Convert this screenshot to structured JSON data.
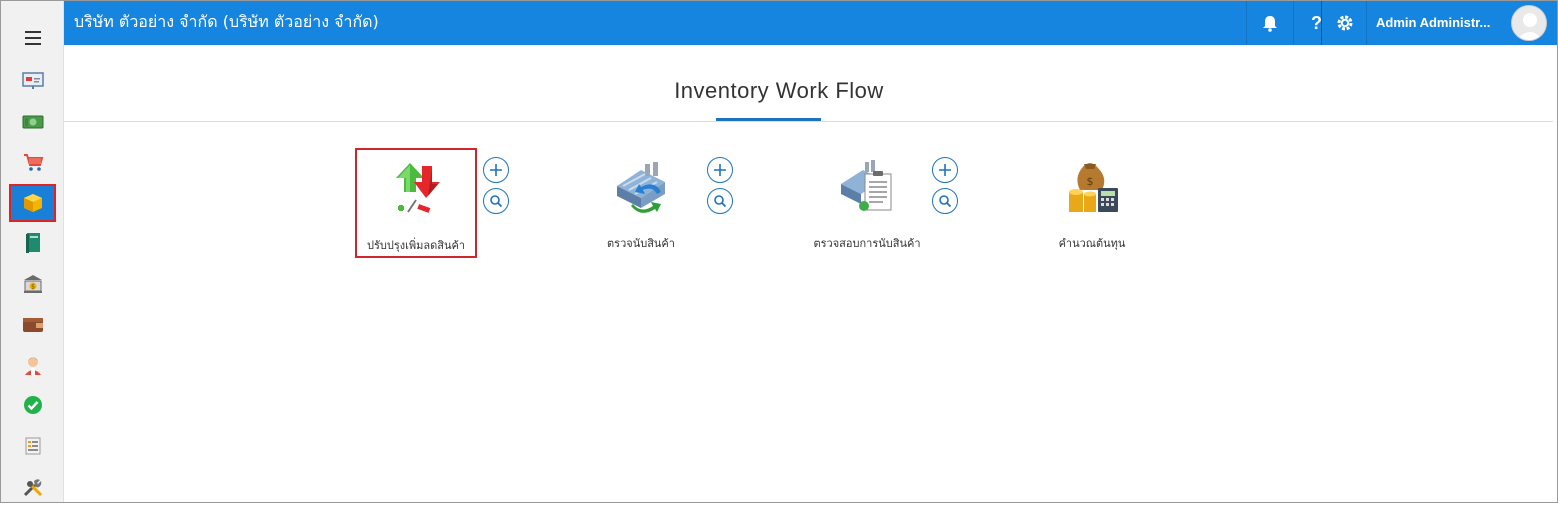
{
  "header": {
    "company": "บริษัท ตัวอย่าง จำกัด (บริษัท ตัวอย่าง จำกัด)",
    "user_name": "Admin Administr...",
    "bg_color": "#1685e0"
  },
  "sidebar": {
    "items": [
      {
        "icon": "presentation-board-icon"
      },
      {
        "icon": "money-icon"
      },
      {
        "icon": "shopping-cart-icon"
      },
      {
        "icon": "inventory-box-icon",
        "active": true
      },
      {
        "icon": "ledger-book-icon"
      },
      {
        "icon": "bank-icon"
      },
      {
        "icon": "wallet-icon"
      },
      {
        "icon": "user-people-icon"
      },
      {
        "icon": "approve-check-icon"
      },
      {
        "icon": "document-list-icon"
      },
      {
        "icon": "tools-icon"
      }
    ]
  },
  "page": {
    "title": "Inventory Work Flow"
  },
  "workflow": {
    "items": [
      {
        "label": "ปรับปรุงเพิ่มลดสินค้า",
        "icon": "stock-adjust-icon",
        "selected": true
      },
      {
        "label": "ตรวจนับสินค้า",
        "icon": "stock-count-icon"
      },
      {
        "label": "ตรวจสอบการนับสินค้า",
        "icon": "count-check-icon"
      },
      {
        "label": "คำนวณต้นทุน",
        "icon": "cost-calc-icon"
      }
    ]
  },
  "colors": {
    "accent": "#1e73be",
    "highlight": "#d0262b"
  }
}
